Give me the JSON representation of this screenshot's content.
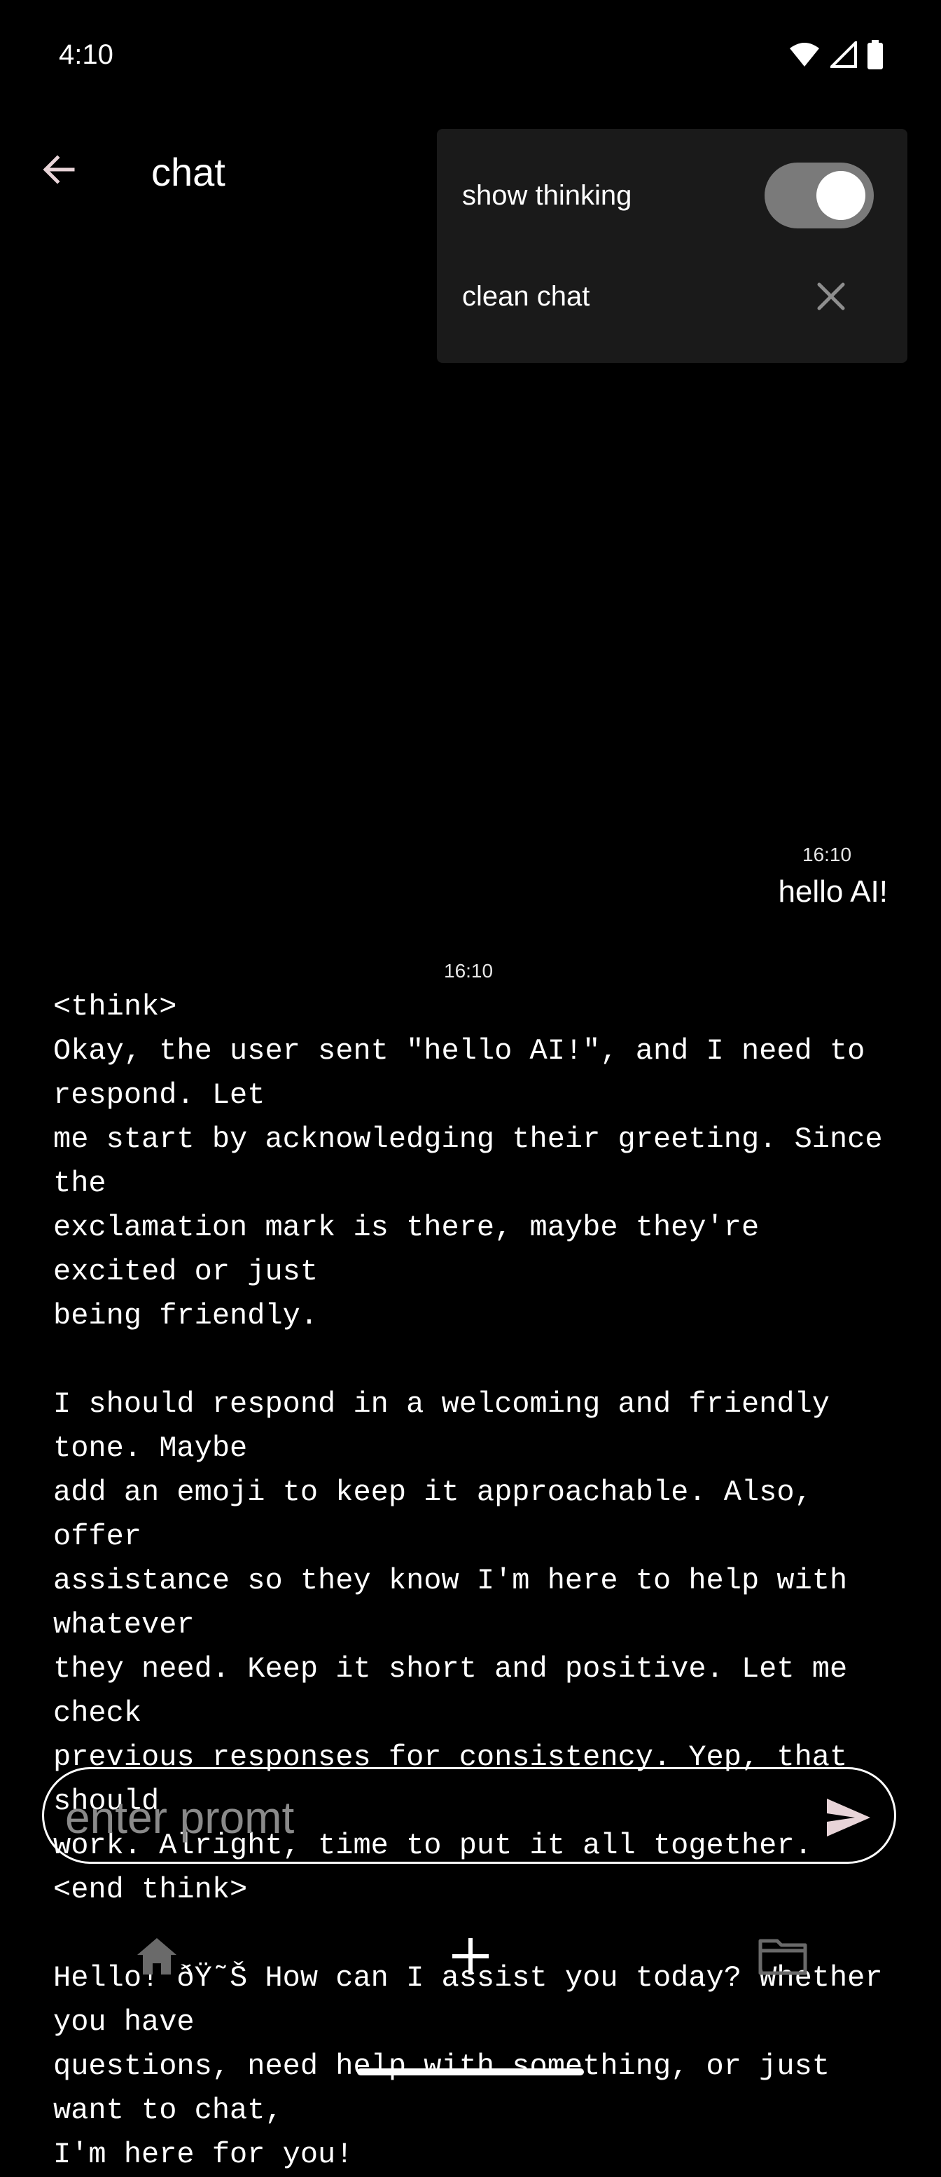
{
  "status_bar": {
    "time": "4:10"
  },
  "app_bar": {
    "title": "chat",
    "back_icon": "arrow-left-icon"
  },
  "menu": {
    "show_thinking_label": "show thinking",
    "show_thinking_on": true,
    "clean_chat_label": "clean chat"
  },
  "messages": [
    {
      "sender": "user",
      "time": "16:10",
      "text": "hello AI!"
    },
    {
      "sender": "assistant",
      "time": "16:10",
      "text": "<think>\nOkay, the user sent \"hello AI!\", and I need to respond. Let\nme start by acknowledging their greeting. Since the\nexclamation mark is there, maybe they're excited or just\nbeing friendly.\n\nI should respond in a welcoming and friendly tone. Maybe\nadd an emoji to keep it approachable. Also, offer\nassistance so they know I'm here to help with whatever\nthey need. Keep it short and positive. Let me check\nprevious responses for consistency. Yep, that should\nwork. Alright, time to put it all together.\n<end think>\n\nHello! ðŸ˜Š How can I assist you today? Whether you have\nquestions, need help with something, or just want to chat,\nI'm here for you!"
    }
  ],
  "input": {
    "placeholder": "enter promt",
    "value": ""
  },
  "bottom_nav": [
    {
      "icon": "home-icon"
    },
    {
      "icon": "plus-icon"
    },
    {
      "icon": "folder-icon"
    }
  ],
  "colors": {
    "background": "#000000",
    "menu_bg": "#1a1a1a",
    "accent_icon": "#e8d4d8",
    "inactive_icon": "#6a6a6a"
  }
}
